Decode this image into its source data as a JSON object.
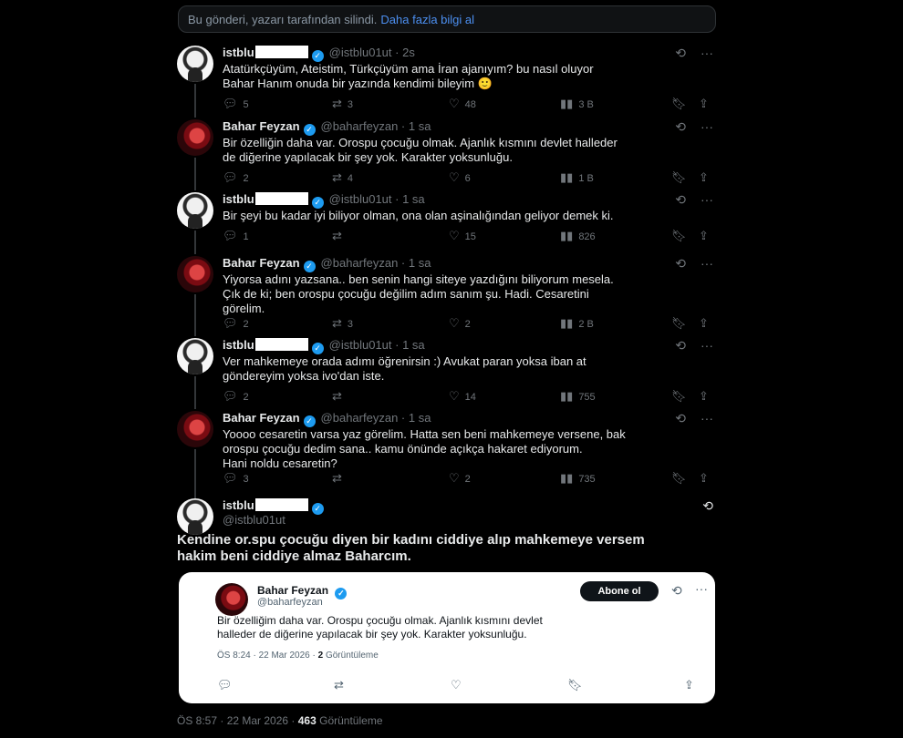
{
  "deleted_notice": {
    "text": "Bu gönderi, yazarı tarafından silindi.",
    "link": "Daha fazla bilgi al"
  },
  "icons": {
    "reply": "reply-icon",
    "retweet": "retweet-icon",
    "like": "like-icon",
    "views": "views-icon",
    "bookmark": "bookmark-icon",
    "share": "share-icon",
    "grok": "grok-icon",
    "more": "more-icon",
    "verified": "verified-badge-icon"
  },
  "tweets": [
    {
      "name": "istblu",
      "handle": "@istblu01ut",
      "time": "2s",
      "text": "Atatürkçüyüm, Ateistim, Türkçüyüm ama İran ajanıyım? bu nasıl oluyor\nBahar Hanım onuda bir yazında kendimi bileyim 🙂",
      "replies": "5",
      "retweets": "3",
      "likes": "48",
      "views": "3 B"
    },
    {
      "name": "Bahar Feyzan",
      "handle": "@baharfeyzan",
      "time": "1 sa",
      "text": "Bir özelliğin daha var. Orospu çocuğu olmak. Ajanlık kısmını devlet halleder\nde diğerine yapılacak bir şey yok. Karakter yoksunluğu.",
      "replies": "2",
      "retweets": "4",
      "likes": "6",
      "views": "1 B"
    },
    {
      "name": "istblu",
      "handle": "@istblu01ut",
      "time": "1 sa",
      "text": "Bir şeyi bu kadar iyi biliyor olman, ona olan aşinalığından geliyor demek ki.",
      "replies": "1",
      "retweets": "",
      "likes": "15",
      "views": "826"
    },
    {
      "name": "Bahar Feyzan",
      "handle": "@baharfeyzan",
      "time": "1 sa",
      "text": "Yiyorsa adını yazsana.. ben senin hangi siteye yazdığını biliyorum mesela.\nÇık de ki; ben orospu çocuğu değilim adım sanım şu. Hadi. Cesaretini\ngörelim.",
      "replies": "2",
      "retweets": "3",
      "likes": "2",
      "views": "2 B"
    },
    {
      "name": "istblu",
      "handle": "@istblu01ut",
      "time": "1 sa",
      "text": "Ver mahkemeye orada adımı öğrenirsin :) Avukat paran yoksa iban at\ngöndereyim yoksa ivo'dan iste.",
      "replies": "2",
      "retweets": "",
      "likes": "14",
      "views": "755"
    },
    {
      "name": "Bahar Feyzan",
      "handle": "@baharfeyzan",
      "time": "1 sa",
      "text": "Yoooo cesaretin varsa yaz görelim. Hatta sen beni mahkemeye versene, bak\norospu çocuğu dedim sana.. kamu önünde açıkça hakaret ediyorum.\nHani noldu cesaretin?",
      "replies": "3",
      "retweets": "",
      "likes": "2",
      "views": "735"
    }
  ],
  "main_tweet": {
    "name": "istblu",
    "handle": "@istblu01ut",
    "text": "Kendine or.spu çocuğu diyen bir kadını ciddiye alıp mahkemeye versem\nhakim beni ciddiye almaz Baharcım.",
    "time": "ÖS 8:57 · 22 Mar 2026 ·",
    "views_count": "463",
    "views_label": "Görüntüleme"
  },
  "quoted": {
    "name": "Bahar Feyzan",
    "handle": "@baharfeyzan",
    "subscribe": "Abone ol",
    "text": "Bir özelliğim daha var. Orospu çocuğu olmak. Ajanlık kısmını devlet\nhalleder de diğerine yapılacak bir şey yok. Karakter yoksunluğu.",
    "time": "ÖS 8:24 · 22 Mar 2026 ·",
    "views_count": "2",
    "views_label": "Görüntüleme"
  }
}
